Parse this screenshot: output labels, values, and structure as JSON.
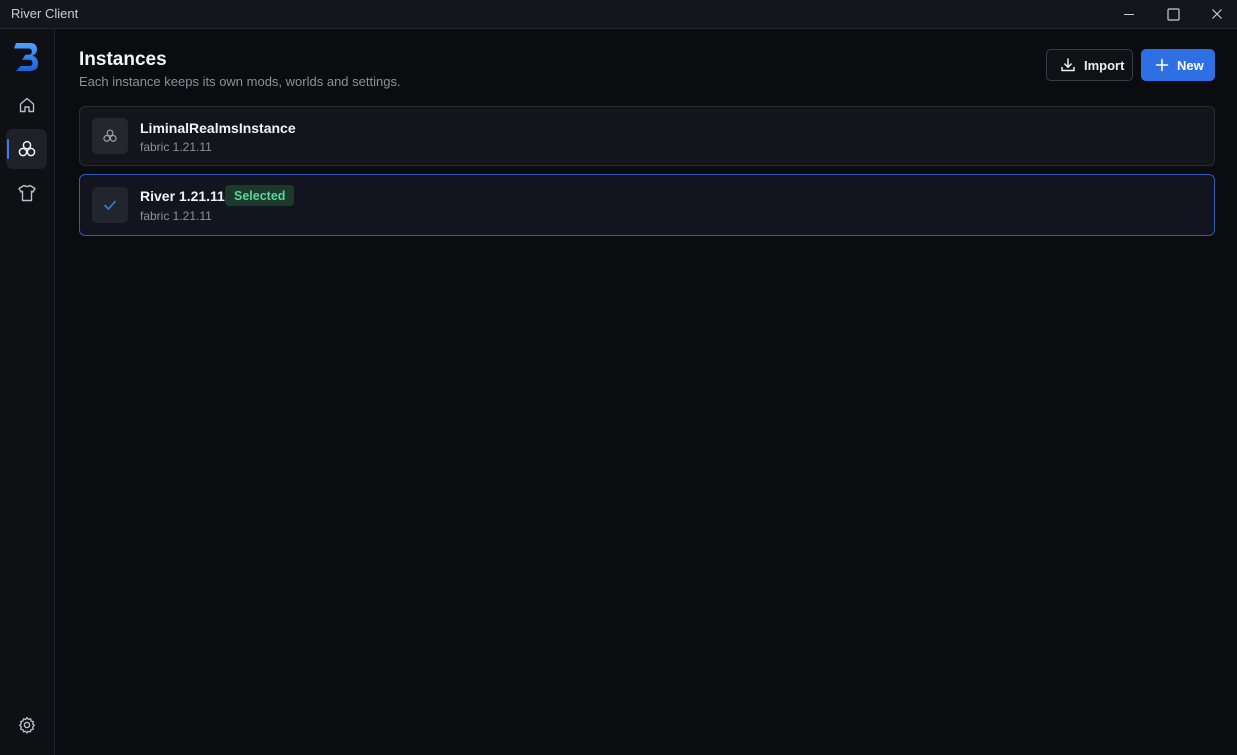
{
  "window": {
    "title": "River Client"
  },
  "sidebar": {
    "items": [
      {
        "icon": "home-icon"
      },
      {
        "icon": "instances-icon",
        "active": true
      },
      {
        "icon": "shirt-icon"
      }
    ],
    "footer_icon": "gear-icon"
  },
  "header": {
    "title": "Instances",
    "subtitle": "Each instance keeps its own mods, worlds and settings.",
    "import_label": "Import",
    "new_label": "New"
  },
  "instances": [
    {
      "name": "LiminalRealmsInstance",
      "meta": "fabric 1.21.11",
      "selected": false
    },
    {
      "name": "River 1.21.11",
      "meta": "fabric 1.21.11",
      "selected": true,
      "badge": "Selected"
    }
  ],
  "colors": {
    "accent": "#2f6fe4",
    "selected_badge_bg": "#1c3a2c",
    "selected_badge_text": "#5ed39a",
    "background": "#0b0c10"
  }
}
